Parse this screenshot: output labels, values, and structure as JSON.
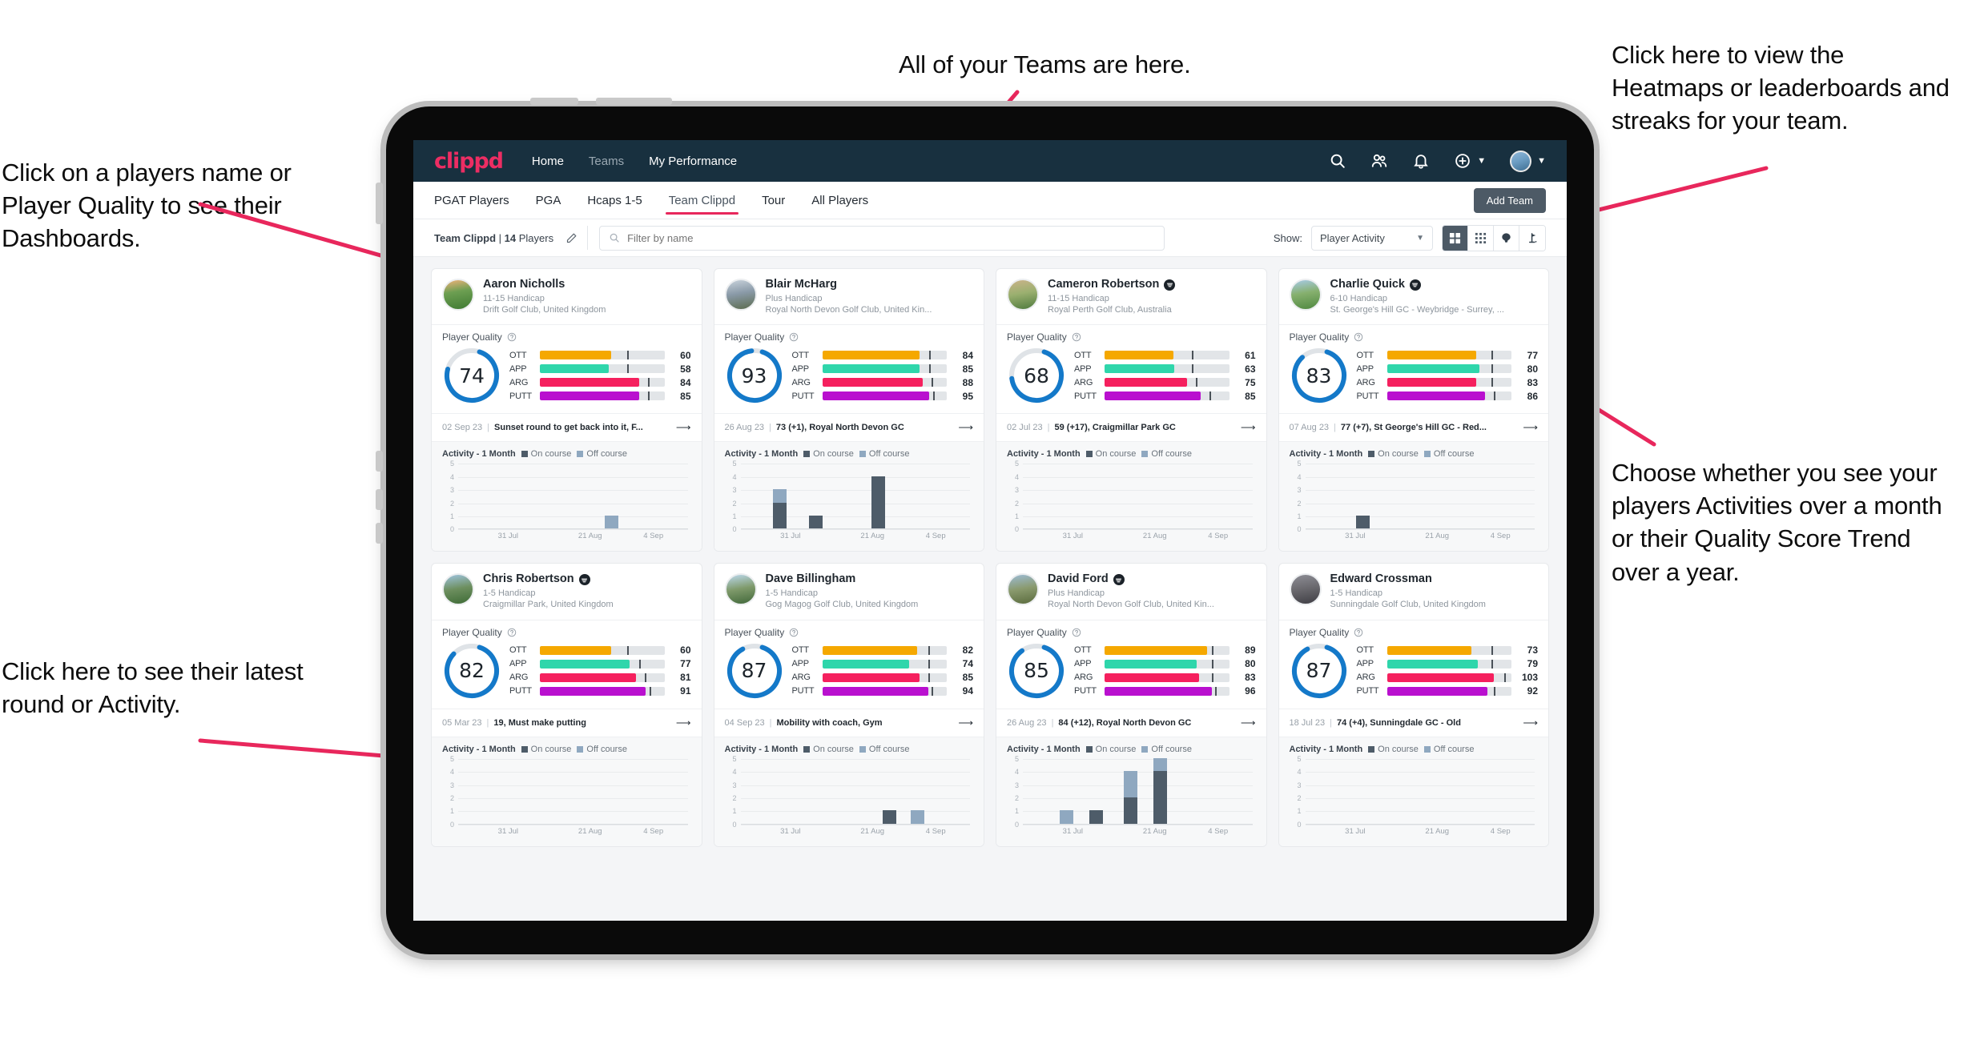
{
  "annotations": {
    "top": "All of your Teams are here.",
    "top_right": "Click here to view the Heatmaps or leaderboards and streaks for your team.",
    "left_top": "Click on a players name or Player Quality to see their Dashboards.",
    "right_mid": "Choose whether you see your players Activities over a month or their Quality Score Trend over a year.",
    "left_bottom": "Click here to see their latest round or Activity.",
    "arrow_color": "#e8275c"
  },
  "app": {
    "brand": "clippd",
    "nav_links": [
      {
        "label": "Home",
        "active": true
      },
      {
        "label": "Teams",
        "active": false
      },
      {
        "label": "My Performance",
        "active": true
      }
    ],
    "nav_icons": [
      "search-icon",
      "people-icon",
      "bell-icon",
      "plus-circle-icon",
      "avatar"
    ],
    "tabs": [
      {
        "label": "PGAT Players",
        "active": false
      },
      {
        "label": "PGA",
        "active": false
      },
      {
        "label": "Hcaps 1-5",
        "active": false
      },
      {
        "label": "Team Clippd",
        "active": true
      },
      {
        "label": "Tour",
        "active": false
      },
      {
        "label": "All Players",
        "active": false
      }
    ],
    "add_team_label": "Add Team",
    "team_label_prefix": "Team Clippd",
    "team_label_sep": " | ",
    "team_label_count": "14",
    "team_label_suffix": " Players",
    "search_placeholder": "Filter by name",
    "show_label": "Show:",
    "show_value": "Player Activity",
    "view_buttons": [
      "grid-view-icon",
      "dots-grid-icon",
      "heatmap-icon",
      "flag-icon"
    ],
    "quality_label": "Player Quality",
    "activity_label": "Activity - 1 Month",
    "legend_on": "On course",
    "legend_off": "Off course",
    "colors": {
      "navy": "#18303f",
      "pink": "#ec2d63",
      "ott": "#f5a800",
      "app": "#2fd6ab",
      "arg": "#f5205e",
      "putt": "#b910cf",
      "gauge": "#1479c9",
      "on_course": "#4e5c69",
      "off_course": "#8fa8c0"
    },
    "chart_axis": {
      "y_ticks": [
        "5",
        "4",
        "3",
        "2",
        "1",
        "0"
      ],
      "x_ticks": [
        "31 Jul",
        "21 Aug",
        "4 Sep"
      ],
      "ymax": 5
    }
  },
  "players": [
    {
      "name": "Aaron Nicholls",
      "verified": false,
      "handicap": "11-15 Handicap",
      "club": "Drift Golf Club, United Kingdom",
      "avatar": "linear-gradient(170deg,#f0b27a 0%,#6d9f52 40%,#3f7a33 100%)",
      "quality": 74,
      "metrics": [
        {
          "label": "OTT",
          "value": 60,
          "color": "#f5a800",
          "fill": 57,
          "tick": 70
        },
        {
          "label": "APP",
          "value": 58,
          "color": "#2fd6ab",
          "fill": 55,
          "tick": 70
        },
        {
          "label": "ARG",
          "value": 84,
          "color": "#f5205e",
          "fill": 80,
          "tick": 87
        },
        {
          "label": "PUTT",
          "value": 85,
          "color": "#b910cf",
          "fill": 80,
          "tick": 87
        }
      ],
      "last_date": "02 Sep 23",
      "last_text": "Sunset round to get back into it, F...",
      "activity": [
        {
          "x": 64,
          "on": 0,
          "off": 1
        }
      ]
    },
    {
      "name": "Blair McHarg",
      "verified": false,
      "handicap": "Plus Handicap",
      "club": "Royal North Devon Golf Club, United Kin...",
      "avatar": "linear-gradient(170deg,#c9d3dc 0%,#8a9aa8 45%,#5b6b4e 100%)",
      "quality": 93,
      "metrics": [
        {
          "label": "OTT",
          "value": 84,
          "color": "#f5a800",
          "fill": 78,
          "tick": 86
        },
        {
          "label": "APP",
          "value": 85,
          "color": "#2fd6ab",
          "fill": 78,
          "tick": 86
        },
        {
          "label": "ARG",
          "value": 88,
          "color": "#f5205e",
          "fill": 81,
          "tick": 88
        },
        {
          "label": "PUTT",
          "value": 95,
          "color": "#b910cf",
          "fill": 86,
          "tick": 89
        }
      ],
      "last_date": "26 Aug 23",
      "last_text": "73 (+1), Royal North Devon GC",
      "activity": [
        {
          "x": 14,
          "on": 2,
          "off": 1
        },
        {
          "x": 30,
          "on": 1,
          "off": 0
        },
        {
          "x": 57,
          "on": 4,
          "off": 0
        }
      ]
    },
    {
      "name": "Cameron Robertson",
      "verified": true,
      "handicap": "11-15 Handicap",
      "club": "Royal Perth Golf Club, Australia",
      "avatar": "linear-gradient(170deg,#cbb38a 0%,#9bb070 45%,#4e7a3d 100%)",
      "quality": 68,
      "metrics": [
        {
          "label": "OTT",
          "value": 61,
          "color": "#f5a800",
          "fill": 55,
          "tick": 70
        },
        {
          "label": "APP",
          "value": 63,
          "color": "#2fd6ab",
          "fill": 56,
          "tick": 70
        },
        {
          "label": "ARG",
          "value": 75,
          "color": "#f5205e",
          "fill": 66,
          "tick": 73
        },
        {
          "label": "PUTT",
          "value": 85,
          "color": "#b910cf",
          "fill": 77,
          "tick": 84
        }
      ],
      "last_date": "02 Jul 23",
      "last_text": "59 (+17), Craigmillar Park GC",
      "activity": []
    },
    {
      "name": "Charlie Quick",
      "verified": true,
      "handicap": "6-10 Handicap",
      "club": "St. George's Hill GC - Weybridge - Surrey, ...",
      "avatar": "linear-gradient(170deg,#a8cbe8 0%,#86b06e 45%,#4f8840 100%)",
      "quality": 83,
      "metrics": [
        {
          "label": "OTT",
          "value": 77,
          "color": "#f5a800",
          "fill": 72,
          "tick": 84
        },
        {
          "label": "APP",
          "value": 80,
          "color": "#2fd6ab",
          "fill": 74,
          "tick": 84
        },
        {
          "label": "ARG",
          "value": 83,
          "color": "#f5205e",
          "fill": 72,
          "tick": 84
        },
        {
          "label": "PUTT",
          "value": 86,
          "color": "#b910cf",
          "fill": 79,
          "tick": 86
        }
      ],
      "last_date": "07 Aug 23",
      "last_text": "77 (+7), St George's Hill GC - Red...",
      "activity": [
        {
          "x": 22,
          "on": 1,
          "off": 0
        }
      ]
    },
    {
      "name": "Chris Robertson",
      "verified": true,
      "handicap": "1-5 Handicap",
      "club": "Craigmillar Park, United Kingdom",
      "avatar": "linear-gradient(170deg,#9fc4e0 0%,#6d8f5f 48%,#3e6b36 100%)",
      "quality": 82,
      "metrics": [
        {
          "label": "OTT",
          "value": 60,
          "color": "#f5a800",
          "fill": 57,
          "tick": 70
        },
        {
          "label": "APP",
          "value": 77,
          "color": "#2fd6ab",
          "fill": 72,
          "tick": 80
        },
        {
          "label": "ARG",
          "value": 81,
          "color": "#f5205e",
          "fill": 77,
          "tick": 84
        },
        {
          "label": "PUTT",
          "value": 91,
          "color": "#b910cf",
          "fill": 85,
          "tick": 88
        }
      ],
      "last_date": "05 Mar 23",
      "last_text": "19, Must make putting",
      "activity": []
    },
    {
      "name": "Dave Billingham",
      "verified": false,
      "handicap": "1-5 Handicap",
      "club": "Gog Magog Golf Club, United Kingdom",
      "avatar": "linear-gradient(170deg,#bcd9ee 0%,#7f9a6b 48%,#41683a 100%)",
      "quality": 87,
      "metrics": [
        {
          "label": "OTT",
          "value": 82,
          "color": "#f5a800",
          "fill": 76,
          "tick": 85
        },
        {
          "label": "APP",
          "value": 74,
          "color": "#2fd6ab",
          "fill": 70,
          "tick": 85
        },
        {
          "label": "ARG",
          "value": 85,
          "color": "#f5205e",
          "fill": 78,
          "tick": 85
        },
        {
          "label": "PUTT",
          "value": 94,
          "color": "#b910cf",
          "fill": 85,
          "tick": 88
        }
      ],
      "last_date": "04 Sep 23",
      "last_text": "Mobility with coach, Gym",
      "activity": [
        {
          "x": 62,
          "on": 1,
          "off": 0
        },
        {
          "x": 74,
          "on": 0,
          "off": 1
        }
      ]
    },
    {
      "name": "David Ford",
      "verified": true,
      "handicap": "Plus Handicap",
      "club": "Royal North Devon Golf Club, United Kin...",
      "avatar": "linear-gradient(170deg,#9dbcd6 0%,#8a9a6e 48%,#5a6b3d 100%)",
      "quality": 85,
      "metrics": [
        {
          "label": "OTT",
          "value": 89,
          "color": "#f5a800",
          "fill": 82,
          "tick": 86
        },
        {
          "label": "APP",
          "value": 80,
          "color": "#2fd6ab",
          "fill": 74,
          "tick": 86
        },
        {
          "label": "ARG",
          "value": 83,
          "color": "#f5205e",
          "fill": 76,
          "tick": 86
        },
        {
          "label": "PUTT",
          "value": 96,
          "color": "#b910cf",
          "fill": 86,
          "tick": 89
        }
      ],
      "last_date": "26 Aug 23",
      "last_text": "84 (+12), Royal North Devon GC",
      "activity": [
        {
          "x": 16,
          "on": 0,
          "off": 1
        },
        {
          "x": 29,
          "on": 1,
          "off": 0
        },
        {
          "x": 44,
          "on": 2,
          "off": 2
        },
        {
          "x": 57,
          "on": 4,
          "off": 1
        }
      ]
    },
    {
      "name": "Edward Crossman",
      "verified": false,
      "handicap": "1-5 Handicap",
      "club": "Sunningdale Golf Club, United Kingdom",
      "avatar": "linear-gradient(170deg,#8e8e96 0%,#6c6b70 45%,#3f3e44 100%)",
      "quality": 87,
      "metrics": [
        {
          "label": "OTT",
          "value": 73,
          "color": "#f5a800",
          "fill": 68,
          "tick": 84
        },
        {
          "label": "APP",
          "value": 79,
          "color": "#2fd6ab",
          "fill": 73,
          "tick": 84
        },
        {
          "label": "ARG",
          "value": 103,
          "color": "#f5205e",
          "fill": 86,
          "tick": 94
        },
        {
          "label": "PUTT",
          "value": 92,
          "color": "#b910cf",
          "fill": 81,
          "tick": 86
        }
      ],
      "last_date": "18 Jul 23",
      "last_text": "74 (+4), Sunningdale GC - Old",
      "activity": []
    }
  ]
}
